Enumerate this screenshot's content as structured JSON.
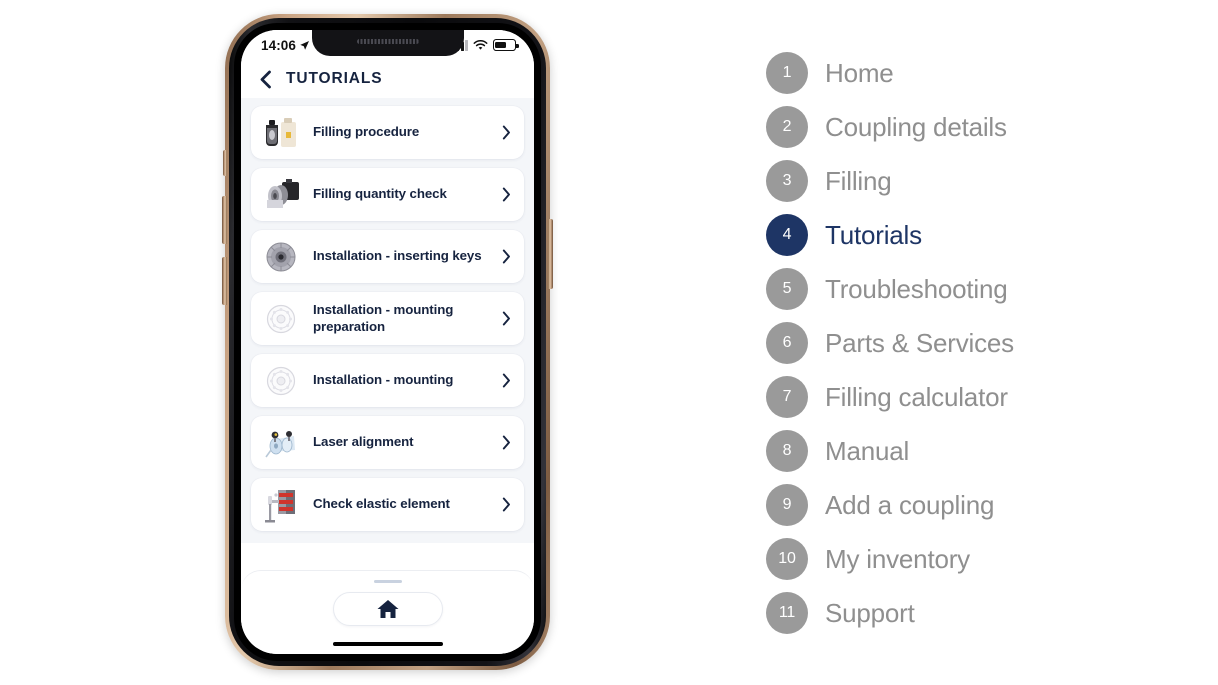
{
  "phone": {
    "status": {
      "time": "14:06",
      "location_icon": "location-arrow-icon",
      "signal_icon": "cellular-signal-icon",
      "wifi_icon": "wifi-icon",
      "battery_icon": "battery-icon"
    },
    "header": {
      "back_icon": "back-chevron-icon",
      "title": "TUTORIALS"
    },
    "tutorials": [
      {
        "label": "Filling procedure",
        "thumb": "coupling-oil-bottle-photo",
        "chevron": "chevron-right-icon"
      },
      {
        "label": "Filling quantity check",
        "thumb": "coupling-motor-photo",
        "chevron": "chevron-right-icon"
      },
      {
        "label": "Installation - inserting keys",
        "thumb": "coupling-disc-photo",
        "chevron": "chevron-right-icon"
      },
      {
        "label": "Installation - mounting preparation",
        "thumb": "coupling-outline-photo",
        "chevron": "chevron-right-icon"
      },
      {
        "label": "Installation - mounting",
        "thumb": "coupling-outline-photo",
        "chevron": "chevron-right-icon"
      },
      {
        "label": "Laser alignment",
        "thumb": "laser-alignment-photo",
        "chevron": "chevron-right-icon"
      },
      {
        "label": "Check elastic element",
        "thumb": "elastic-element-gauge-photo",
        "chevron": "chevron-right-icon"
      }
    ],
    "bottom": {
      "drag_handle": "drag-handle",
      "home_icon": "home-icon",
      "home_indicator": "home-indicator"
    }
  },
  "menu": {
    "items": [
      {
        "num": "1",
        "label": "Home",
        "active": false
      },
      {
        "num": "2",
        "label": "Coupling details",
        "active": false
      },
      {
        "num": "3",
        "label": "Filling",
        "active": false
      },
      {
        "num": "4",
        "label": "Tutorials",
        "active": true
      },
      {
        "num": "5",
        "label": "Troubleshooting",
        "active": false
      },
      {
        "num": "6",
        "label": "Parts & Services",
        "active": false
      },
      {
        "num": "7",
        "label": "Filling calculator",
        "active": false
      },
      {
        "num": "8",
        "label": "Manual",
        "active": false
      },
      {
        "num": "9",
        "label": "Add a coupling",
        "active": false
      },
      {
        "num": "10",
        "label": "My inventory",
        "active": false
      },
      {
        "num": "11",
        "label": "Support",
        "active": false
      }
    ]
  },
  "colors": {
    "accent_navy": "#1e3565",
    "text_navy": "#16233f",
    "inactive_gray": "#9a9a9a",
    "label_gray": "#8f8f8f",
    "list_bg": "#f4f6f9"
  }
}
